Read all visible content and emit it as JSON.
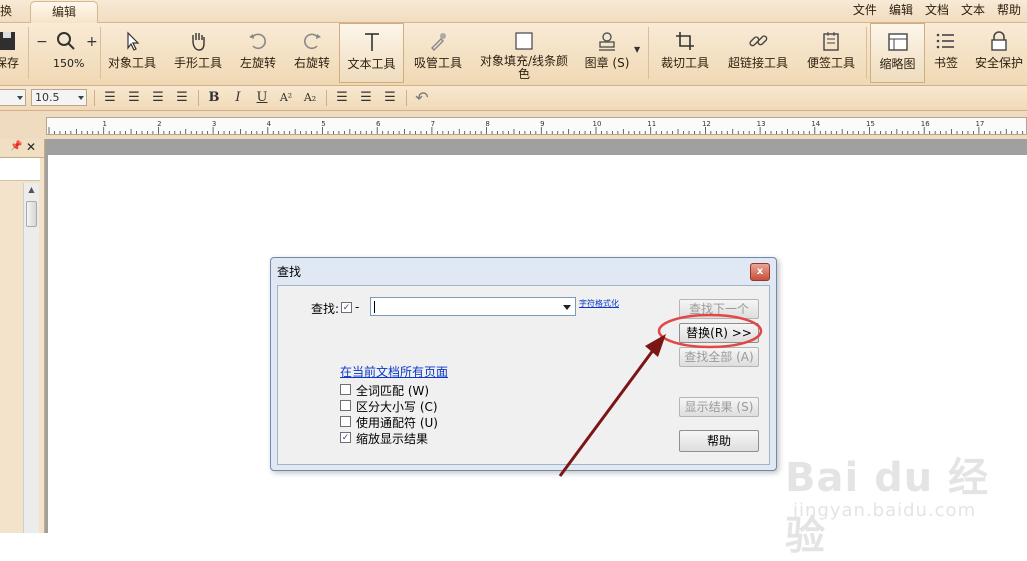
{
  "tabs": {
    "prev_label": "换",
    "edit_label": "编辑"
  },
  "menu": [
    "文件",
    "编辑",
    "文档",
    "文本",
    "帮助"
  ],
  "ribbon": {
    "save_label": "保存",
    "zoom_value": "150%",
    "object_tool": "对象工具",
    "hand_tool": "手形工具",
    "rotate_left": "左旋转",
    "rotate_right": "右旋转",
    "text_tool": "文本工具",
    "eyedropper_tool": "吸管工具",
    "fill_color_line1": "对象填充/线条颜",
    "fill_color_line2": "色",
    "stamp": "图章 (S)",
    "crop_tool": "裁切工具",
    "link_tool": "超链接工具",
    "note_tool": "便签工具",
    "thumbnail": "缩略图",
    "bookmark": "书签",
    "security": "安全保护"
  },
  "format_bar": {
    "font_size": "10.5",
    "bold": "B",
    "italic": "I",
    "underline": "U",
    "superscript": "A²",
    "subscript": "A₂"
  },
  "ruler_numbers": [
    "1",
    "2",
    "3",
    "4",
    "5",
    "6",
    "7",
    "8",
    "9",
    "10",
    "11",
    "12",
    "13",
    "14",
    "15",
    "16",
    "17"
  ],
  "dialog": {
    "title": "查找",
    "close": "x",
    "find_label": "查找:",
    "dash": "-",
    "format_link": "字符格式化",
    "scope_link": "在当前文档所有页面",
    "options": [
      {
        "label": "全词匹配 (W)",
        "checked": false
      },
      {
        "label": "区分大小写 (C)",
        "checked": false
      },
      {
        "label": "使用通配符 (U)",
        "checked": false
      },
      {
        "label": "缩放显示结果",
        "checked": true
      }
    ],
    "btn_find_next": "查找下一个",
    "btn_replace": "替换(R) >>",
    "btn_find_all": "查找全部 (A)",
    "btn_show_results": "显示结果 (S)",
    "btn_help": "帮助"
  },
  "watermark": {
    "main": "Bai du 经验",
    "sub": "jingyan.baidu.com"
  },
  "colors": {
    "ribbon": "#f0d8b4",
    "annotation": "#8b1a1a",
    "link": "#0a38c9"
  }
}
